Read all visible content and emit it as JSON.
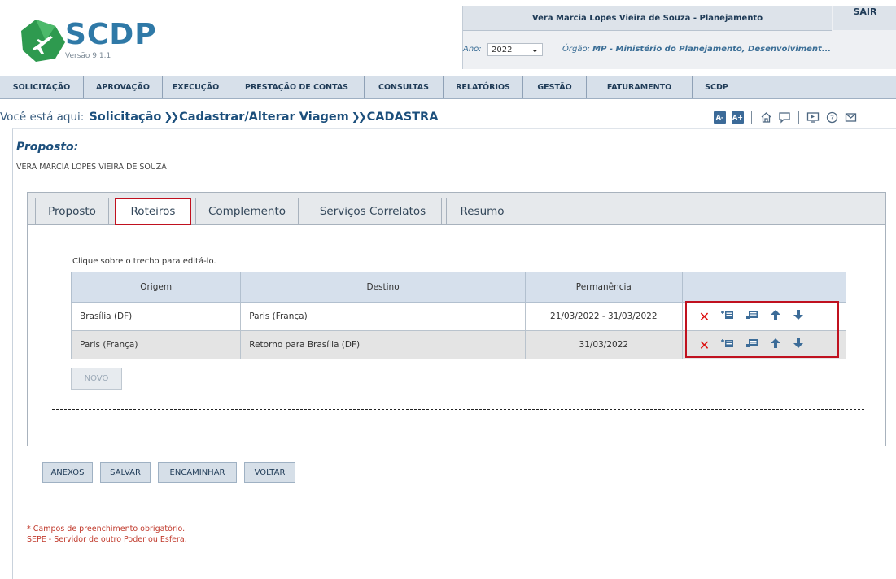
{
  "header": {
    "logo_text": "SCDP",
    "version": "Versão 9.1.1",
    "user": "Vera Marcia Lopes Vieira de Souza - Planejamento",
    "logout": "SAIR",
    "ano_label": "Ano:",
    "ano_value": "2022",
    "orgao_label": "Órgão:",
    "orgao_value": "MP - Ministério do Planejamento, Desenvolviment..."
  },
  "nav": [
    "SOLICITAÇÃO",
    "APROVAÇÃO",
    "EXECUÇÃO",
    "PRESTAÇÃO DE CONTAS",
    "CONSULTAS",
    "RELATÓRIOS",
    "GESTÃO",
    "FATURAMENTO",
    "SCDP"
  ],
  "breadcrumb": {
    "label": "Você está aqui:",
    "items": [
      "Solicitação",
      "Cadastrar/Alterar Viagem",
      "CADASTRA"
    ]
  },
  "tools": {
    "font_smaller": "A-",
    "font_larger": "A+"
  },
  "proposto": {
    "title": "Proposto:",
    "name": "VERA MARCIA LOPES VIEIRA DE SOUZA"
  },
  "tabs": [
    "Proposto",
    "Roteiros",
    "Complemento",
    "Serviços Correlatos",
    "Resumo"
  ],
  "active_tab": "Roteiros",
  "hint": "Clique sobre o trecho para editá-lo.",
  "table": {
    "columns": [
      "Origem",
      "Destino",
      "Permanência",
      ""
    ],
    "rows": [
      {
        "origem": "Brasília (DF)",
        "destino": "Paris (França)",
        "permanencia": "21/03/2022 - 31/03/2022"
      },
      {
        "origem": "Paris (França)",
        "destino": "Retorno para Brasília (DF)",
        "permanencia": "31/03/2022"
      }
    ]
  },
  "buttons": {
    "novo": "NOVO",
    "anexos": "ANEXOS",
    "salvar": "SALVAR",
    "encaminhar": "ENCAMINHAR",
    "voltar": "VOLTAR"
  },
  "footer": {
    "line1": "* Campos de preenchimento obrigatório.",
    "line2": "SEPE - Servidor de outro Poder ou Esfera."
  },
  "colors": {
    "accent": "#1c4f7c",
    "highlight": "#c0111f",
    "nav_bg": "#d7e0ea"
  }
}
